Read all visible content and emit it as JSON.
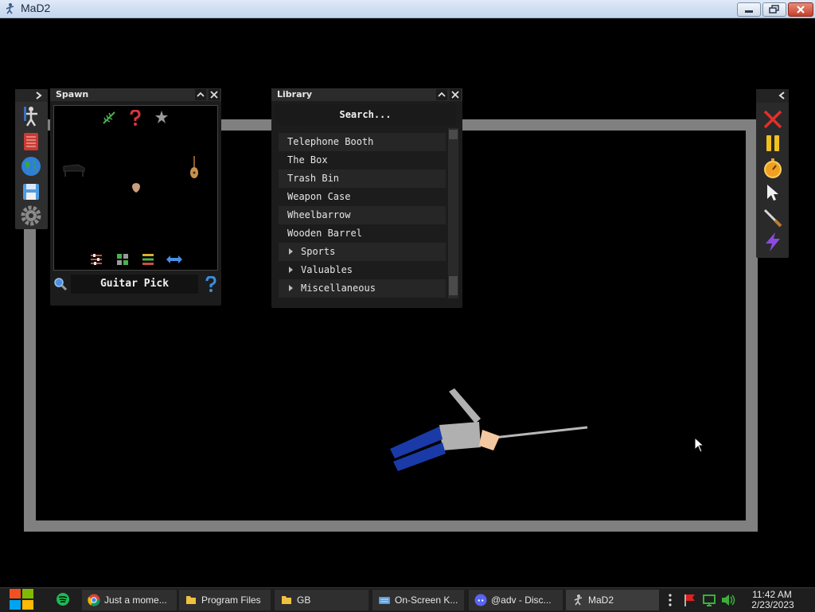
{
  "window": {
    "title": "MaD2"
  },
  "spawn_panel": {
    "title": "Spawn",
    "selected_item": "Guitar Pick"
  },
  "library_panel": {
    "title": "Library",
    "search_placeholder": "Search...",
    "items": [
      {
        "label": "Telephone Booth",
        "type": "item"
      },
      {
        "label": "The Box",
        "type": "item"
      },
      {
        "label": "Trash Bin",
        "type": "item"
      },
      {
        "label": "Weapon Case",
        "type": "item"
      },
      {
        "label": "Wheelbarrow",
        "type": "item"
      },
      {
        "label": "Wooden Barrel",
        "type": "item"
      },
      {
        "label": "Sports",
        "type": "category"
      },
      {
        "label": "Valuables",
        "type": "category"
      },
      {
        "label": "Miscellaneous",
        "type": "category"
      }
    ]
  },
  "taskbar": {
    "items": [
      {
        "label": "Just a mome...",
        "icon": "chrome-icon"
      },
      {
        "label": "Program Files",
        "icon": "folder-icon"
      },
      {
        "label": "GB",
        "icon": "folder-icon"
      },
      {
        "label": "On-Screen K...",
        "icon": "keyboard-icon"
      },
      {
        "label": "@adv - Disc...",
        "icon": "discord-icon"
      },
      {
        "label": "MaD2",
        "icon": "mad2-icon"
      }
    ],
    "clock_time": "11:42 AM",
    "clock_date": "2/23/2023"
  },
  "colors": {
    "arena_wall": "#808080",
    "panel_bg": "#1c1c1c",
    "taskbar_bg": "#1e1e1e"
  }
}
